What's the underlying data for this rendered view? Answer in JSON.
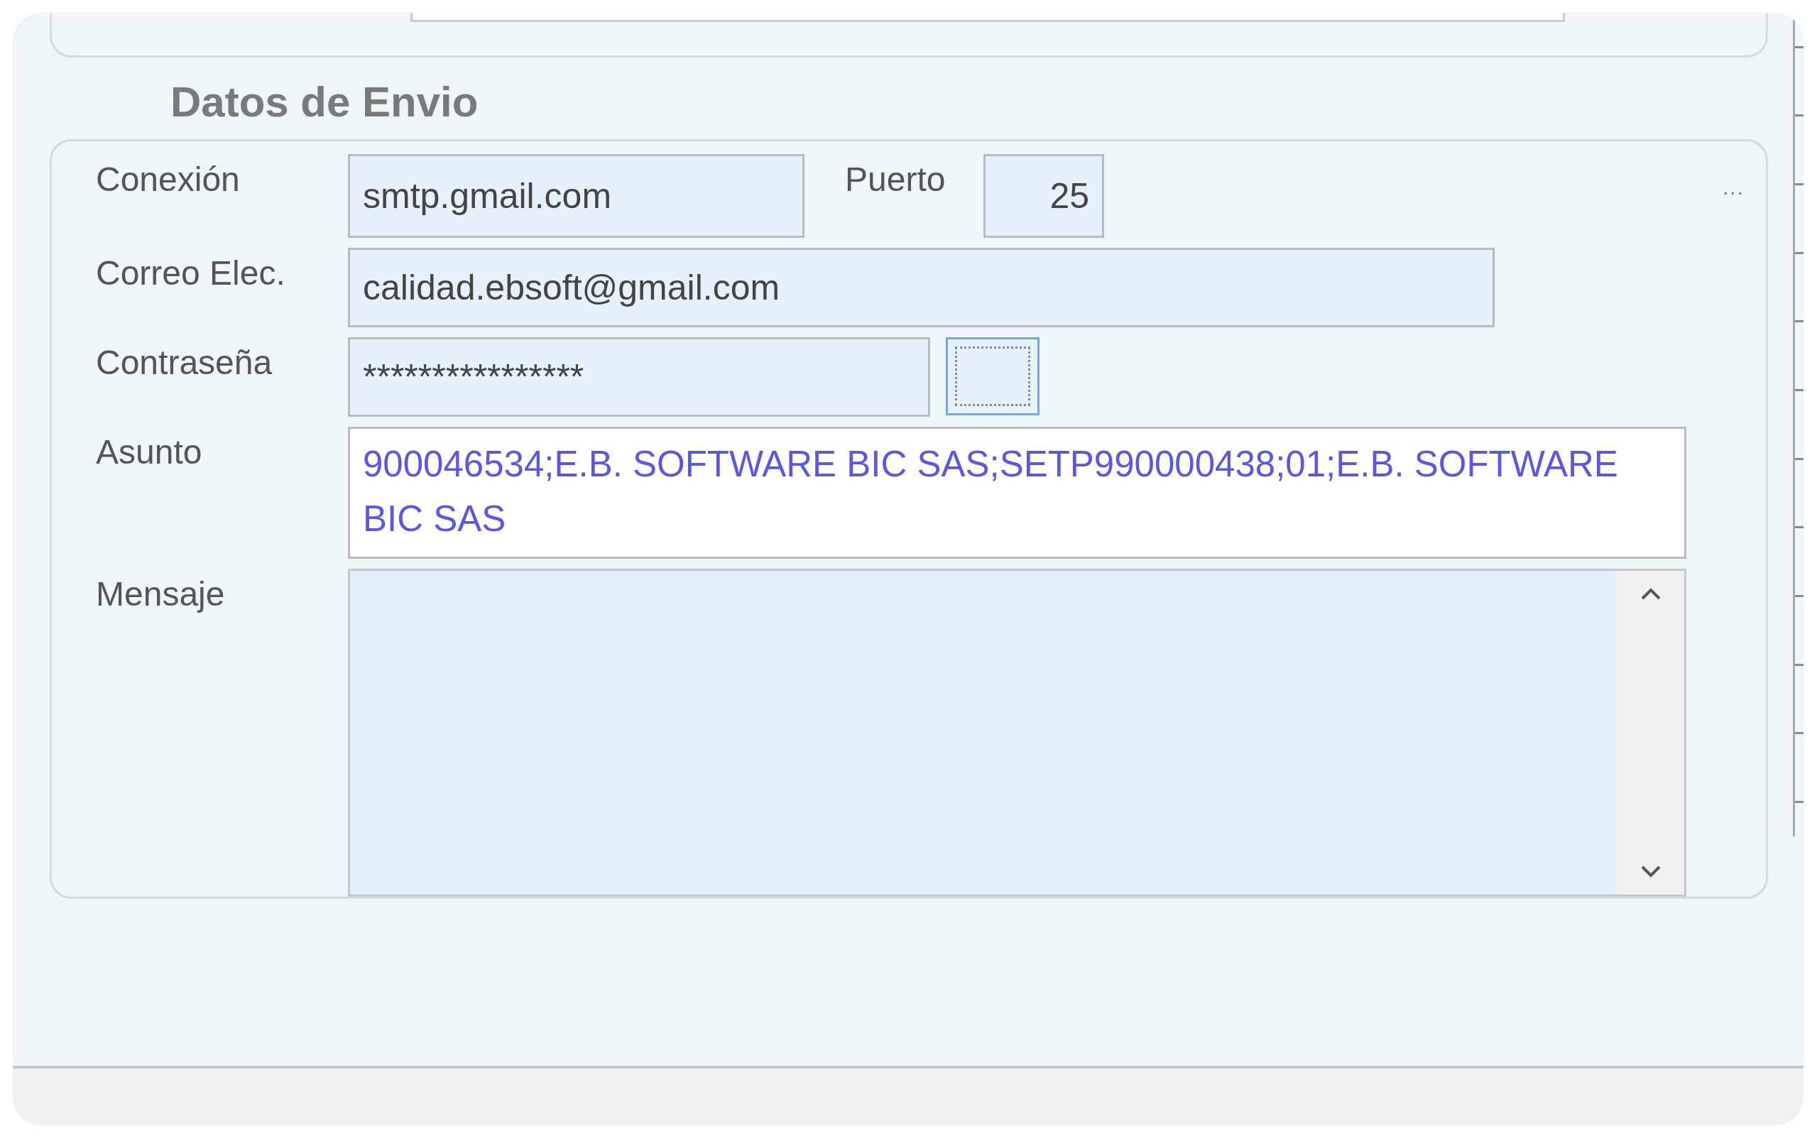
{
  "section_title": "Datos de Envio",
  "connection": {
    "label": "Conexión",
    "value": "smtp.gmail.com"
  },
  "port": {
    "label": "Puerto",
    "value": "25"
  },
  "more": "...",
  "email": {
    "label": "Correo Elec.",
    "value": "calidad.ebsoft@gmail.com"
  },
  "password": {
    "label": "Contraseña",
    "value": "****************"
  },
  "subject": {
    "label": "Asunto",
    "value": "900046534;E.B. SOFTWARE BIC SAS;SETP990000438;01;E.B. SOFTWARE BIC SAS"
  },
  "message": {
    "label": "Mensaje"
  }
}
